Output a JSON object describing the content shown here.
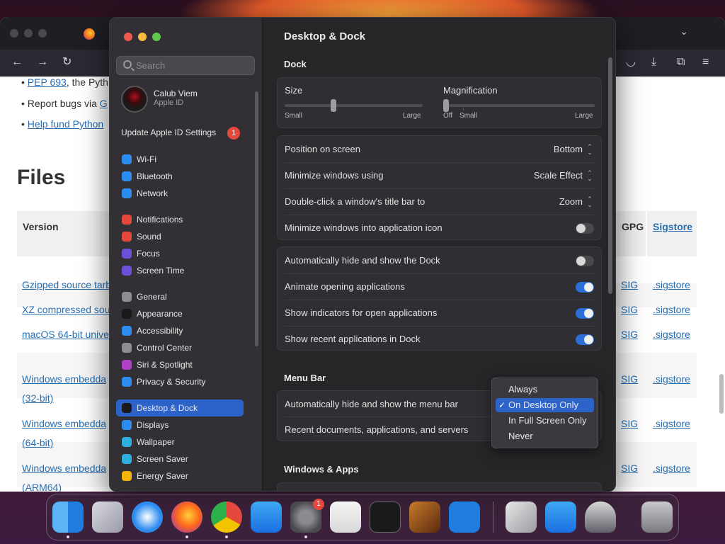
{
  "browser": {
    "bullets": [
      {
        "link": "PEP 693",
        "text": ", the Pyth"
      },
      {
        "prefix": "Report bugs via ",
        "link": "G"
      },
      {
        "link": "Help fund Python"
      }
    ],
    "heading": "Files",
    "columns": {
      "version": "Version",
      "gpg": "GPG",
      "sigstore": "Sigstore"
    },
    "rows": [
      {
        "name": "Gzipped source tarb",
        "sig": "SIG",
        "sigstore": ".sigstore"
      },
      {
        "name": "XZ compressed sou",
        "sig": "SIG",
        "sigstore": ".sigstore"
      },
      {
        "name": "macOS 64-bit unive",
        "sig": "SIG",
        "sigstore": ".sigstore"
      },
      {
        "name": "Windows embedda",
        "name2": "(32-bit)",
        "sig": "SIG",
        "sigstore": ".sigstore"
      },
      {
        "name": "Windows embedda",
        "name2": "(64-bit)",
        "sig": "SIG",
        "sigstore": ".sigstore"
      },
      {
        "name": "Windows embedda",
        "name2": "(ARM64)",
        "sig": "SIG",
        "sigstore": ".sigstore"
      }
    ]
  },
  "sidebar": {
    "search_placeholder": "Search",
    "account_name": "Calub Viem",
    "account_sub": "Apple ID",
    "update_label": "Update Apple ID Settings",
    "update_badge": "1",
    "items": [
      {
        "label": "Wi-Fi",
        "icon": "wifi-icon",
        "color": "#2d8cf0"
      },
      {
        "label": "Bluetooth",
        "icon": "bluetooth-icon",
        "color": "#2d8cf0"
      },
      {
        "label": "Network",
        "icon": "globe-icon",
        "color": "#2d8cf0"
      },
      {
        "label": "Notifications",
        "icon": "bell-icon",
        "color": "#e5483c"
      },
      {
        "label": "Sound",
        "icon": "speaker-icon",
        "color": "#e5483c"
      },
      {
        "label": "Focus",
        "icon": "moon-icon",
        "color": "#6b50d8"
      },
      {
        "label": "Screen Time",
        "icon": "hourglass-icon",
        "color": "#6b50d8"
      },
      {
        "label": "General",
        "icon": "gear-icon",
        "color": "#8d8d92"
      },
      {
        "label": "Appearance",
        "icon": "circle-half-icon",
        "color": "#1a1a1a"
      },
      {
        "label": "Accessibility",
        "icon": "person-icon",
        "color": "#2d8cf0"
      },
      {
        "label": "Control Center",
        "icon": "switches-icon",
        "color": "#8d8d92"
      },
      {
        "label": "Siri & Spotlight",
        "icon": "siri-icon",
        "color": "#b040c8"
      },
      {
        "label": "Privacy & Security",
        "icon": "hand-icon",
        "color": "#2d8cf0"
      },
      {
        "label": "Desktop & Dock",
        "icon": "dock-icon",
        "color": "#1a1a1a",
        "active": true
      },
      {
        "label": "Displays",
        "icon": "sun-icon",
        "color": "#2d8cf0"
      },
      {
        "label": "Wallpaper",
        "icon": "flower-icon",
        "color": "#2dafe0"
      },
      {
        "label": "Screen Saver",
        "icon": "screensaver-icon",
        "color": "#2dafe0"
      },
      {
        "label": "Energy Saver",
        "icon": "battery-icon",
        "color": "#f2b400"
      }
    ]
  },
  "main": {
    "title": "Desktop & Dock",
    "dock_section": "Dock",
    "size_label": "Size",
    "size_small": "Small",
    "size_large": "Large",
    "size_value": 0.35,
    "mag_label": "Magnification",
    "mag_off": "Off",
    "mag_small": "Small",
    "mag_large": "Large",
    "position_label": "Position on screen",
    "position_value": "Bottom",
    "minimize_label": "Minimize windows using",
    "minimize_value": "Scale Effect",
    "doubleclick_label": "Double-click a window's title bar to",
    "doubleclick_value": "Zoom",
    "minimize_icon_label": "Minimize windows into application icon",
    "autohide_label": "Automatically hide and show the Dock",
    "animate_label": "Animate opening applications",
    "indicators_label": "Show indicators for open applications",
    "recent_label": "Show recent applications in Dock",
    "menubar_section": "Menu Bar",
    "menubar_autohide_label": "Automatically hide and show the menu bar",
    "recent_docs_label": "Recent documents, applications, and servers",
    "windows_section": "Windows & Apps",
    "accent": "#2d6fd9"
  },
  "menu": {
    "options": [
      "Always",
      "On Desktop Only",
      "In Full Screen Only",
      "Never"
    ],
    "selected": "On Desktop Only"
  },
  "dock": {
    "apps": [
      "Finder",
      "Launchpad",
      "Safari",
      "Firefox",
      "Chrome",
      "App Store",
      "System Settings",
      "TextEdit",
      "Terminal",
      "Instruments",
      "VS Code",
      "Utility",
      "Keynote",
      "Rocket",
      "Trash"
    ],
    "settings_badge": "1"
  }
}
